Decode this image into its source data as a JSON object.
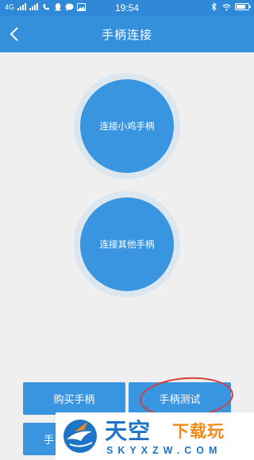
{
  "status_bar": {
    "network": "4G",
    "time": "19:54"
  },
  "header": {
    "title": "手柄连接"
  },
  "main": {
    "connect_xiaoji_label": "连接小鸡手柄",
    "connect_other_label": "连接其他手柄"
  },
  "bottom": {
    "buy_label": "购买手柄",
    "test_label": "手柄测试",
    "partial_label": "手"
  },
  "watermark": {
    "brand_blue": "天空",
    "brand_orange": "下载玩",
    "domain": "SKYXZW.COM"
  },
  "colors": {
    "accent": "#3590dc",
    "circle": "#3a95e0",
    "background": "#efefef",
    "annotation_red": "#d93a3a"
  }
}
